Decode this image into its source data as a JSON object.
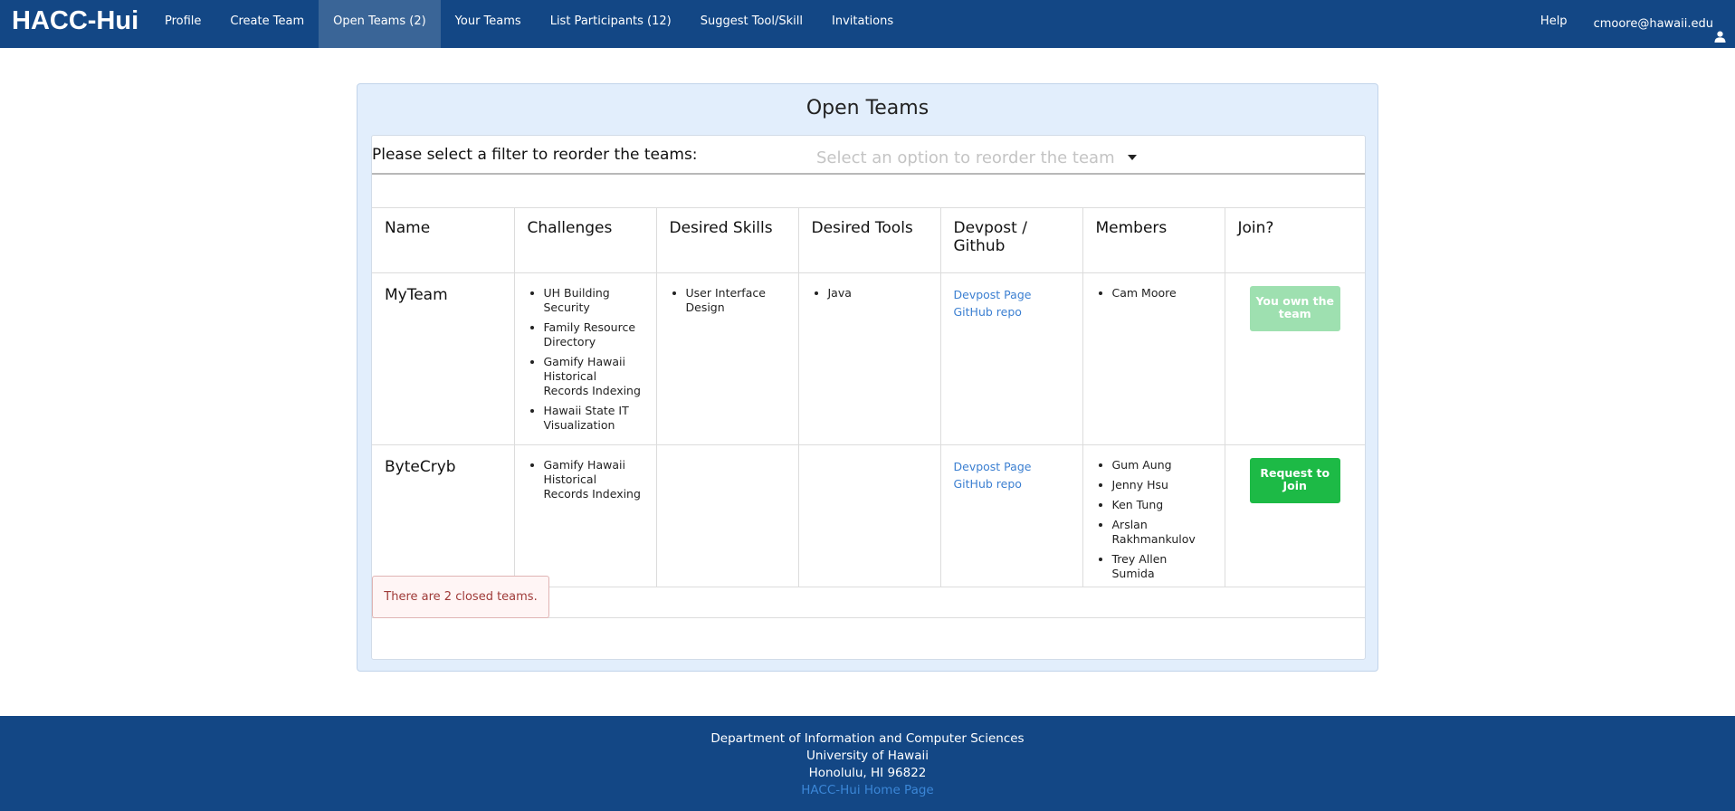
{
  "nav": {
    "brand": "HACC-Hui",
    "items": [
      {
        "label": "Profile"
      },
      {
        "label": "Create Team"
      },
      {
        "label": "Open Teams (2)"
      },
      {
        "label": "Your Teams"
      },
      {
        "label": "List Participants (12)"
      },
      {
        "label": "Suggest Tool/Skill"
      },
      {
        "label": "Invitations"
      }
    ],
    "help": "Help",
    "user": "cmoore@hawaii.edu",
    "user_icon": "user-icon"
  },
  "panel": {
    "title": "Open Teams",
    "filter_label": "Please select a filter to reorder the teams:",
    "filter_placeholder": "Select an option to reorder the team"
  },
  "table": {
    "headers": [
      "Name",
      "Challenges",
      "Desired Skills",
      "Desired Tools",
      "Devpost / Github",
      "Members",
      "Join?"
    ],
    "rows": [
      {
        "name": "MyTeam",
        "challenges": [
          "UH Building Security",
          "Family Resource Directory",
          "Gamify Hawaii Historical Records Indexing",
          "Hawaii State IT Visualization"
        ],
        "skills": [
          "User Interface Design"
        ],
        "tools": [
          "Java"
        ],
        "devpost": "Devpost Page",
        "github": "GitHub repo",
        "members": [
          "Cam Moore"
        ],
        "join": "You own the team"
      },
      {
        "name": "ByteCryb",
        "challenges": [
          "Gamify Hawaii Historical Records Indexing"
        ],
        "skills": [],
        "tools": [],
        "devpost": "Devpost Page",
        "github": "GitHub repo",
        "members": [
          "Gum Aung",
          "Jenny Hsu",
          "Ken Tung",
          "Arslan Rakhmankulov",
          "Trey Allen Sumida"
        ],
        "join": "Request to Join"
      }
    ]
  },
  "closed_message": "There are 2 closed teams.",
  "footer": {
    "line1": "Department of Information and Computer Sciences",
    "line2": "University of Hawaii",
    "line3": "Honolulu, HI 96822",
    "link": "HACC-Hui Home Page"
  },
  "colors": {
    "navbar": "#134785",
    "active_tab": "#3a6597",
    "panel_bg": "#e2eefc",
    "join_button": "#1dba46",
    "own_button": "#9ee0b0",
    "link": "#3b7fd1"
  }
}
